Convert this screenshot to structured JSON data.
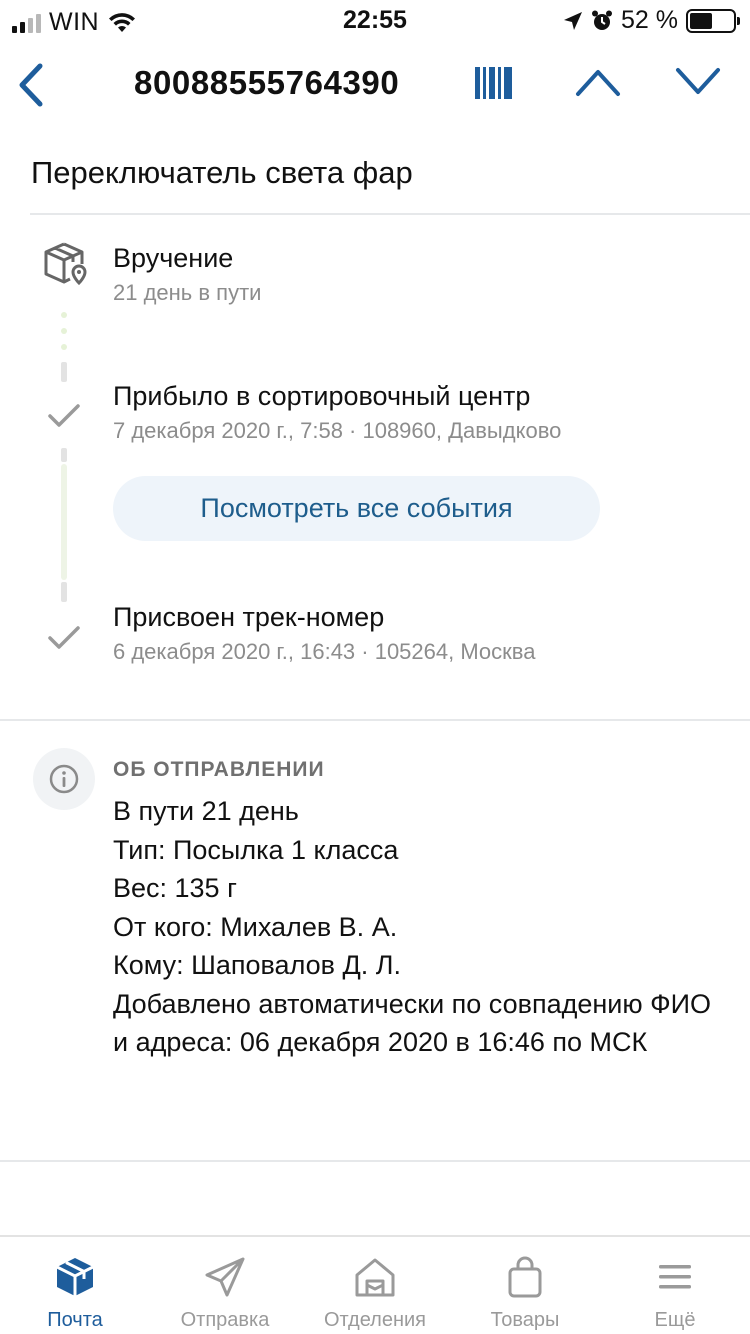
{
  "status_bar": {
    "carrier": "WIN",
    "time": "22:55",
    "battery_text": "52 %",
    "battery_level": 0.52
  },
  "nav": {
    "track_number": "80088555764390",
    "back_icon": "chevron-left-icon",
    "barcode_icon": "barcode-icon",
    "prev_icon": "chevron-up-icon",
    "next_icon": "chevron-down-icon"
  },
  "item_title": "Переключатель света фар",
  "timeline": {
    "delivery": {
      "title": "Вручение",
      "subtitle": "21 день в пути",
      "icon": "package-location-icon"
    },
    "events": [
      {
        "title": "Прибыло в сортировочный центр",
        "subtitle": "7 декабря 2020 г., 7:58 · 108960, Давыдково"
      },
      {
        "title": "Присвоен трек-номер",
        "subtitle": "6 декабря 2020 г., 16:43 · 105264, Москва"
      }
    ],
    "view_all_label": "Посмотреть все события"
  },
  "info": {
    "header": "ОБ ОТПРАВЛЕНИИ",
    "lines": [
      "В пути 21 день",
      "Тип: Посылка 1 класса",
      "Вес: 135 г",
      "От кого: Михалев В. А.",
      "Кому: Шаповалов Д. Л.",
      "Добавлено автоматически по совпадению ФИО и адреса: 06 декабря 2020 в 16:46 по МСК"
    ]
  },
  "tabs": [
    {
      "label": "Почта",
      "icon": "parcel-box-icon",
      "active": true
    },
    {
      "label": "Отправка",
      "icon": "paper-plane-icon",
      "active": false
    },
    {
      "label": "Отделения",
      "icon": "post-office-icon",
      "active": false
    },
    {
      "label": "Товары",
      "icon": "shopping-bag-icon",
      "active": false
    },
    {
      "label": "Ещё",
      "icon": "menu-icon",
      "active": false
    }
  ],
  "colors": {
    "accent": "#1E5D9C",
    "button_bg": "#EEF4FA",
    "muted_text": "#8C8C8C",
    "divider": "#E6E8EA"
  }
}
